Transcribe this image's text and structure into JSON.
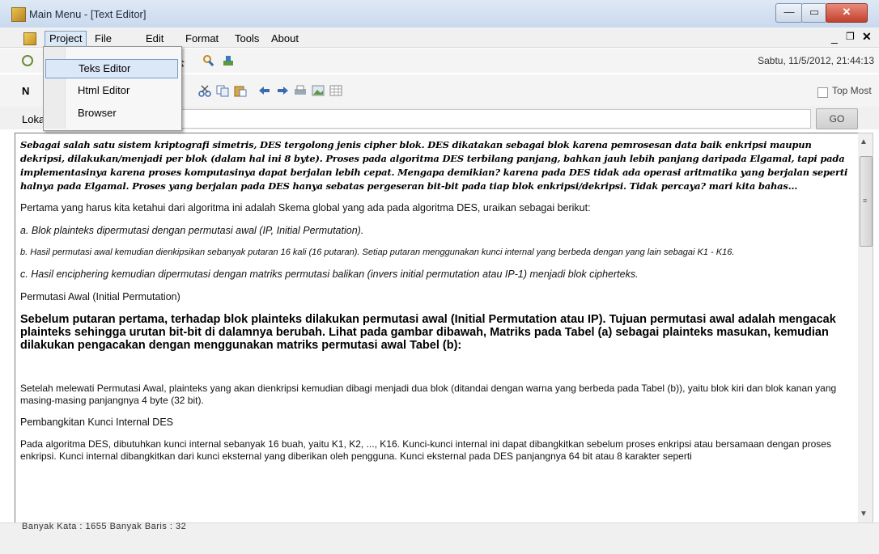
{
  "window": {
    "title": "Main Menu - [Text Editor]",
    "controls": {
      "minimize": "—",
      "maximize": "▭",
      "close": "✕"
    }
  },
  "menubar": {
    "items": [
      "Project",
      "File",
      "Edit",
      "Format",
      "Tools",
      "About"
    ],
    "mdi_controls": {
      "minimize": "_",
      "restore": "❐",
      "close": "✕"
    }
  },
  "project_menu": {
    "items": [
      "Teks Editor",
      "Html Editor",
      "Browser"
    ],
    "highlighted": "Teks Editor"
  },
  "toolbar": {
    "datetime": "Sabtu, 11/5/2012, 21:44:13",
    "bold_label": "N",
    "icons": [
      "cut-icon",
      "copy-icon",
      "paste-icon",
      "undo-icon",
      "redo-icon",
      "find-icon",
      "replace-icon",
      "image-icon"
    ]
  },
  "topmost": {
    "label": "Top Most",
    "checked": false
  },
  "location": {
    "label": "Lokasi",
    "value": "",
    "go_label": "GO"
  },
  "editor": {
    "paragraphs": [
      "Sebagai salah satu sistem kriptografi simetris, DES tergolong jenis cipher blok. DES dikatakan sebagai blok karena pemrosesan data baik enkripsi maupun dekripsi, dilakukan/menjadi per blok (dalam hal ini 8 byte). Proses pada algoritma DES terbilang panjang, bahkan jauh lebih panjang daripada Elgamal, tapi pada implementasinya karena proses komputasinya dapat berjalan lebih cepat. Mengapa demikian? karena pada DES tidak ada operasi aritmatika yang berjalan seperti halnya pada Elgamal. Proses yang berjalan pada DES hanya sebatas pergeseran bit-bit pada tiap blok enkripsi/dekripsi. Tidak percaya? mari kita bahas...",
      "Pertama yang harus kita ketahui dari algoritma ini adalah Skema global yang ada pada algoritma DES, uraikan sebagai berikut:",
      "a. Blok plainteks dipermutasi dengan permutasi awal (IP, Initial Permutation).",
      "b. Hasil permutasi awal kemudian dienkipsikan sebanyak putaran 16 kali (16 putaran). Setiap putaran menggunakan kunci internal yang berbeda dengan yang lain sebagai K1 - K16.",
      "c. Hasil enciphering kemudian dipermutasi dengan matriks permutasi balikan (invers initial permutation atau IP-1) menjadi blok cipherteks.",
      "Permutasi Awal (Initial Permutation)",
      "Sebelum putaran pertama, terhadap blok plainteks dilakukan permutasi awal (Initial Permutation atau IP). Tujuan permutasi awal adalah mengacak plainteks sehingga urutan bit-bit di dalamnya berubah. Lihat pada gambar dibawah, Matriks pada Tabel (a) sebagai plainteks masukan, kemudian dilakukan pengacakan dengan menggunakan matriks permutasi awal Tabel (b):",
      "Setelah melewati Permutasi Awal, plainteks yang akan dienkripsi kemudian dibagi menjadi dua blok (ditandai dengan warna yang berbeda pada Tabel (b)), yaitu blok kiri dan blok kanan yang masing-masing panjangnya 4 byte (32 bit).",
      "Pembangkitan Kunci Internal DES",
      "Pada algoritma DES, dibutuhkan kunci internal sebanyak 16 buah, yaitu K1, K2, ..., K16. Kunci-kunci internal ini dapat dibangkitkan sebelum proses enkripsi atau bersamaan dengan proses enkripsi. Kunci internal dibangkitkan dari kunci eksternal yang diberikan oleh pengguna. Kunci eksternal pada DES panjangnya 64 bit atau 8 karakter seperti"
    ]
  },
  "status": {
    "text": "Banyak Kata : 1655    Banyak Baris : 32"
  },
  "colors": {
    "titlebar": "#c9d9ee",
    "menu_highlight": "#dbe8f7",
    "close": "#c2412c"
  }
}
